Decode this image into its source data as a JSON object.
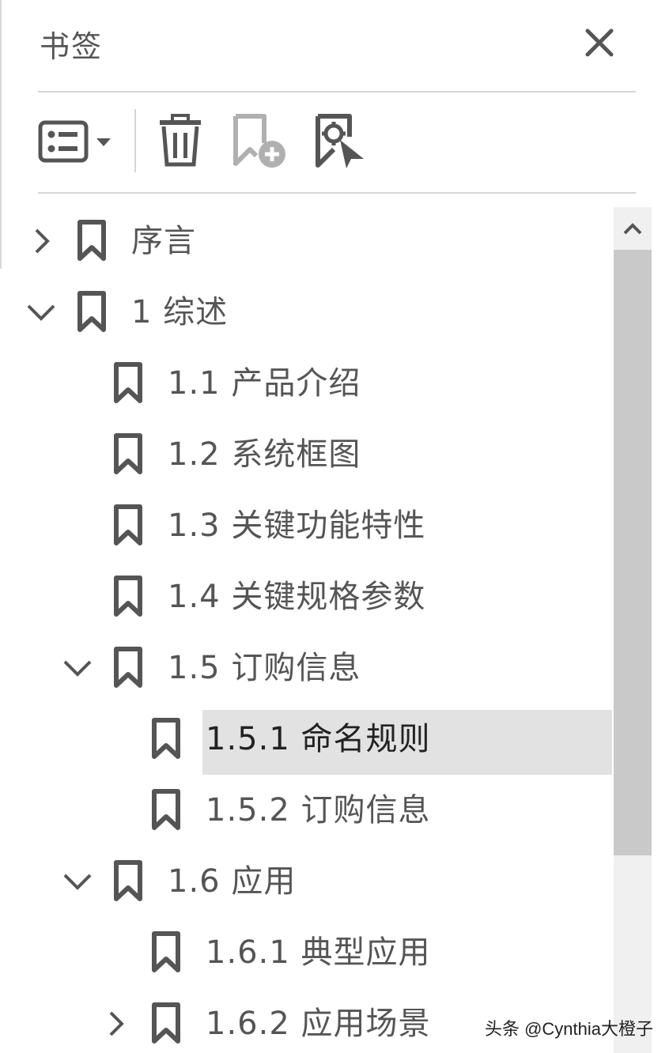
{
  "panel": {
    "title": "书签"
  },
  "toolbar": {
    "options_icon": "list-options-icon",
    "delete_icon": "trash-icon",
    "add_icon": "add-bookmark-icon",
    "locate_icon": "locate-bookmark-icon"
  },
  "bookmarks": [
    {
      "label": "序言",
      "expander": "collapsed"
    },
    {
      "label": "1 综述",
      "expander": "expanded"
    },
    {
      "label": "1.1 产品介绍",
      "expander": "none"
    },
    {
      "label": "1.2 系统框图",
      "expander": "none"
    },
    {
      "label": "1.3 关键功能特性",
      "expander": "none"
    },
    {
      "label": "1.4 关键规格参数",
      "expander": "none"
    },
    {
      "label": "1.5 订购信息",
      "expander": "expanded"
    },
    {
      "label": "1.5.1 命名规则",
      "expander": "none",
      "selected": true
    },
    {
      "label": "1.5.2 订购信息",
      "expander": "none"
    },
    {
      "label": "1.6 应用",
      "expander": "expanded"
    },
    {
      "label": "1.6.1 典型应用",
      "expander": "none"
    },
    {
      "label": "1.6.2 应用场景",
      "expander": "collapsed"
    }
  ],
  "watermark": "头条 @Cynthia大橙子",
  "colors": {
    "icon": "#555555",
    "disabled_icon": "#b0b0b0",
    "selected_bg": "#e2e2e2",
    "scroll_thumb": "#c9c9c9"
  }
}
